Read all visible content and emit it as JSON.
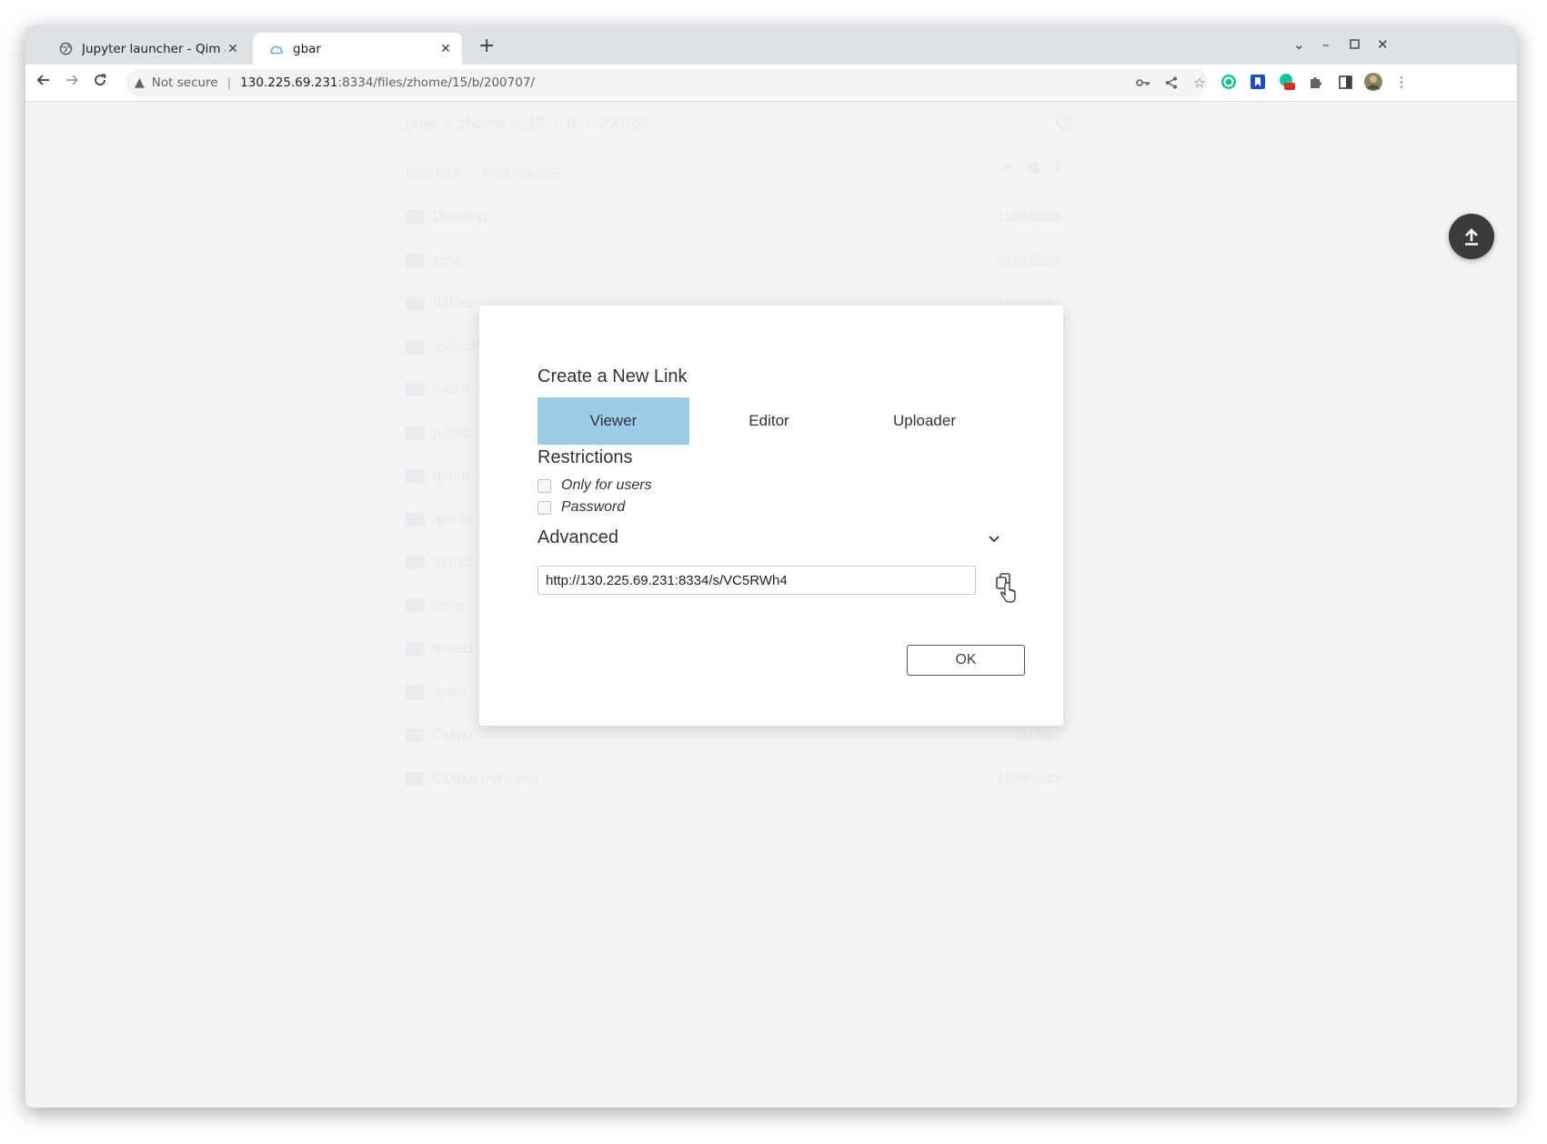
{
  "browser": {
    "tabs": [
      {
        "title": "Jupyter launcher - Qim app",
        "active": false
      },
      {
        "title": "gbar",
        "active": true
      }
    ],
    "new_tab_label": "+",
    "address": {
      "security_label": "Not secure",
      "host": "130.225.69.231",
      "path": ":8334/files/zhome/15/b/200707/"
    }
  },
  "background": {
    "breadcrumb": [
      "gbar",
      "zhome",
      "15",
      "b",
      "200707"
    ],
    "actions": [
      "NEW FILE",
      "NEW FOLDER"
    ],
    "items": [
      {
        "name": "Desktop",
        "date": "11/05/2023"
      },
      {
        "name": "envs",
        "date": "02/08/2023"
      },
      {
        "name": "h5files",
        "date": "11/08/2023"
      },
      {
        "name": "minico",
        "date": "06/2023"
      },
      {
        "name": "noteb",
        "date": "08/2023"
      },
      {
        "name": "public",
        "date": "03/2023"
      },
      {
        "name": "qim-a",
        "date": "08/2023"
      },
      {
        "name": "qim-to",
        "date": "03/2023"
      },
      {
        "name": "qim3d",
        "date": "08/2023"
      },
      {
        "name": "temp",
        "date": "05/2023"
      },
      {
        "name": "tested",
        "date": "08/2023"
      },
      {
        "name": "uploa",
        "date": "08/2023"
      },
      {
        "name": "Outpu",
        "date": "08/2023"
      },
      {
        "name": "Output.out",
        "size": "2.3 KB",
        "date": "17/08/2023"
      }
    ]
  },
  "dialog": {
    "title": "Create a New Link",
    "tabs": [
      {
        "label": "Viewer",
        "selected": true
      },
      {
        "label": "Editor",
        "selected": false
      },
      {
        "label": "Uploader",
        "selected": false
      }
    ],
    "restrictions_title": "Restrictions",
    "restrictions": [
      {
        "label": "Only for users",
        "checked": false
      },
      {
        "label": "Password",
        "checked": false
      }
    ],
    "advanced_label": "Advanced",
    "link_value": "http://130.225.69.231:8334/s/VC5RWh4",
    "ok_label": "OK"
  },
  "colors": {
    "selected_tab": "#9ccce8",
    "fab": "#3b3b3b",
    "page_bg": "#f2f3f5"
  }
}
